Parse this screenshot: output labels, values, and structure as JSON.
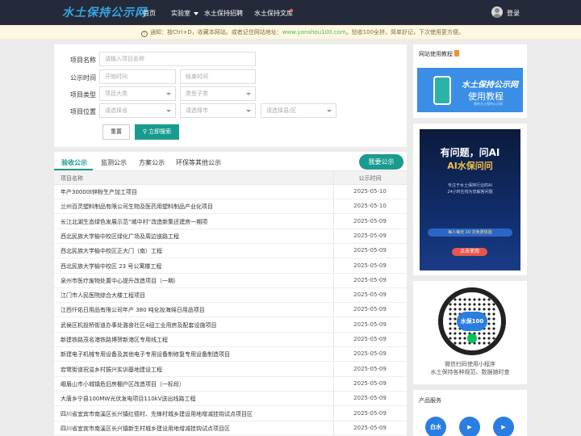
{
  "nav": {
    "logo": "水土保持公示网",
    "items": [
      "首页",
      "实验室",
      "水土保持招聘",
      "水土保持文库"
    ],
    "login": "登录"
  },
  "notice": {
    "icon": "speaker-icon",
    "text_before": "通知：按Ctrl+D，收藏本网站。或者记住网站地址：",
    "site": "www.yanshou100.com",
    "text_after": "。验收100全拼，简单好记，下次使用更方便。"
  },
  "filters": {
    "name_label": "项目名称",
    "name_placeholder": "请输入项目名称",
    "time_label": "公示时间",
    "start_placeholder": "开始时间",
    "end_placeholder": "结束时间",
    "type_label": "项目类型",
    "type_big": "项目大类",
    "type_sub": "类型子类",
    "loc_label": "项目位置",
    "province": "请选择省",
    "city": "请选择市",
    "county": "请选择县/区",
    "reset": "重置",
    "search": "立即搜索"
  },
  "tabs": [
    "验收公示",
    "监测公示",
    "方案公示",
    "环保等其他公示"
  ],
  "publish_btn": "我要公示",
  "table": {
    "col_name": "项目名称",
    "col_time": "公示时间",
    "rows": [
      {
        "name": "年产30000t锌粉生产加工项目",
        "date": "2025-05-10"
      },
      {
        "name": "兰州百灵塑料制品有限公司生物及医药用塑料制品产业化项目",
        "date": "2025-05-10"
      },
      {
        "name": "长江北湖生态绿色发展示范“城中村”改造新集还建房一期项",
        "date": "2025-05-09"
      },
      {
        "name": "西北民族大学榆中校区绿化广场及周边道路工程",
        "date": "2025-05-09"
      },
      {
        "name": "西北民族大学榆中校区正大门（南）工程",
        "date": "2025-05-09"
      },
      {
        "name": "西北民族大学榆中校区 23 号公寓楼工程",
        "date": "2025-05-09"
      },
      {
        "name": "泉州市医疗废物处置中心提升改造项目（一期）",
        "date": "2025-05-09"
      },
      {
        "name": "江门市人民医院综合大楼工程项目",
        "date": "2025-05-09"
      },
      {
        "name": "江西仟佑日用品有限公司年产 380 吨化妆海绵日用品项目",
        "date": "2025-05-09"
      },
      {
        "name": "武侯区机投桥街道办事处潞食社区4组工业用房及配套设施项目",
        "date": "2025-05-09"
      },
      {
        "name": "新建铁路茂名港铁路博贺新港区专用线工程",
        "date": "2025-05-09"
      },
      {
        "name": "新建电子机械专用设备及其他电子专用设备制修复专用设备制造项目",
        "date": "2025-05-09"
      },
      {
        "name": "宕鹭街道祝溢乡村振兴实训基地建设工程",
        "date": "2025-05-09"
      },
      {
        "name": "峨眉山市小城镇危旧房棚户区改造项目（一标段）",
        "date": "2025-05-09"
      },
      {
        "name": "大唐乡宁县100MW光伏发电项目110kV送出线路工程",
        "date": "2025-05-09"
      },
      {
        "name": "四川省宜宾市南溪区长兴镇红德村、先锋村城乡建设用地增减挂钩试点项目区",
        "date": "2025-05-09"
      },
      {
        "name": "四川省宜宾市南溪区长兴镇新生村城乡建设用地增减挂钩试点项目区",
        "date": "2025-05-09"
      }
    ]
  },
  "side": {
    "tutorial_title": "网站使用教程",
    "banner1_title": "水土保持公示网",
    "banner1_sub": "使用教程",
    "banner1_small": "我的水土保持公示网",
    "banner2_title": "有问题，问AI",
    "banner2_sub": "AI水保问问",
    "banner2_desc1": "专注于水土保持行业的AI",
    "banner2_desc2": "24小时在线为您解答问题",
    "banner2_bar": "每人每天 10 次免费体验",
    "banner2_go": "点击使用",
    "qr_center": "水保100",
    "qr_text1": "微信扫码使用小程序",
    "qr_text2": "水土保持各种规范、数据随时查",
    "services_title": "产品服务",
    "svc1": "白水",
    "svc2": "▶",
    "svc3": "▶"
  }
}
